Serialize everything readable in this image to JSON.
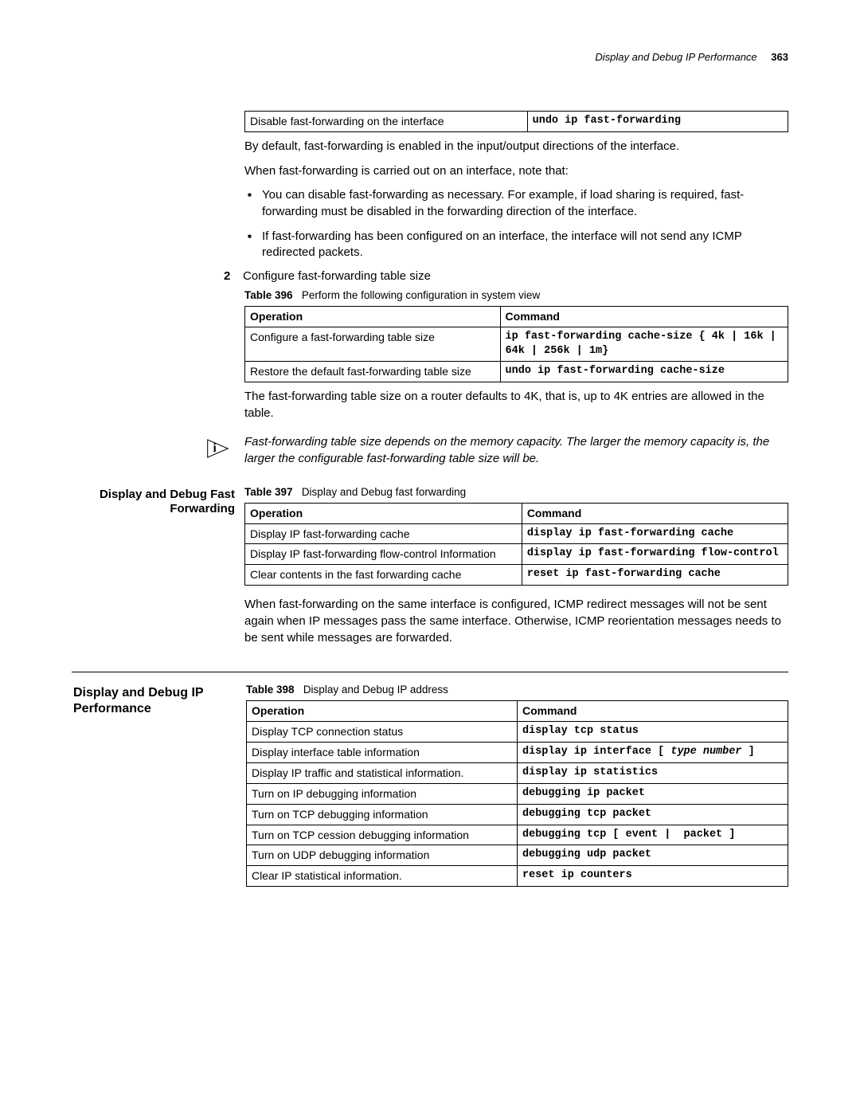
{
  "header": {
    "running_title": "Display and Debug IP Performance",
    "page_number": "363"
  },
  "table395": {
    "rows": [
      {
        "op": "Disable fast-forwarding on the interface",
        "cmd": "undo ip fast-forwarding"
      }
    ]
  },
  "p_default": "By default, fast-forwarding is enabled in the input/output directions of the interface.",
  "p_when_ff": "When fast-forwarding is carried out on an interface, note that:",
  "bullets_ff": [
    "You can disable fast-forwarding as necessary. For example, if load sharing is required, fast-forwarding must be disabled in the forwarding direction of the interface.",
    "If fast-forwarding has been configured on an interface, the interface will not send any ICMP redirected packets."
  ],
  "step2": {
    "num": "2",
    "text": "Configure fast-forwarding table size"
  },
  "table396": {
    "caption_label": "Table 396",
    "caption_text": "Perform the following configuration in system view",
    "headers": {
      "op": "Operation",
      "cmd": "Command"
    },
    "rows": [
      {
        "op": "Configure a fast-forwarding table size",
        "cmd": "ip fast-forwarding cache-size { 4k | 16k | 64k | 256k | 1m}"
      },
      {
        "op": "Restore the default fast-forwarding table size",
        "cmd": "undo ip fast-forwarding cache-size"
      }
    ]
  },
  "p_table_default": "The fast-forwarding table size on a router defaults to 4K, that is, up to 4K entries are allowed in the table.",
  "note_ff_size": "Fast-forwarding table size depends on the memory capacity. The larger the memory capacity is, the larger the configurable fast-forwarding table size will be.",
  "side_dd_ff": "Display and Debug Fast Forwarding",
  "table397": {
    "caption_label": "Table 397",
    "caption_text": "Display and Debug fast forwarding",
    "headers": {
      "op": "Operation",
      "cmd": "Command"
    },
    "rows": [
      {
        "op": "Display IP fast-forwarding cache",
        "cmd": "display ip fast-forwarding cache"
      },
      {
        "op": "Display IP fast-forwarding flow-control Information",
        "cmd": "display ip fast-forwarding flow-control"
      },
      {
        "op": "Clear contents in the fast forwarding cache",
        "cmd": "reset ip fast-forwarding cache"
      }
    ]
  },
  "p_ff_icmp": "When fast-forwarding on the same interface is configured, ICMP redirect messages will not be sent again when IP messages pass the same interface. Otherwise, ICMP reorientation messages needs to be sent while messages are forwarded.",
  "side_dd_ip_perf": "Display and Debug IP Performance",
  "table398": {
    "caption_label": "Table 398",
    "caption_text": "Display and Debug IP address",
    "headers": {
      "op": "Operation",
      "cmd": "Command"
    },
    "rows": [
      {
        "op": "Display TCP connection status",
        "cmd": "display tcp status"
      },
      {
        "op": "Display interface table information",
        "cmd": "display ip interface [ type number ]",
        "cmd_html": "display ip interface [ <i>type number</i> ]"
      },
      {
        "op": "Display IP traffic and statistical information.",
        "cmd": "display ip statistics"
      },
      {
        "op": "Turn on IP debugging information",
        "cmd": "debugging ip packet"
      },
      {
        "op": "Turn on TCP debugging information",
        "cmd": "debugging tcp packet"
      },
      {
        "op": "Turn on TCP cession debugging information",
        "cmd": "debugging tcp [ event |  packet ]"
      },
      {
        "op": "Turn on UDP debugging information",
        "cmd": "debugging udp packet"
      },
      {
        "op": "Clear IP statistical information.",
        "cmd": "reset ip counters"
      }
    ]
  }
}
